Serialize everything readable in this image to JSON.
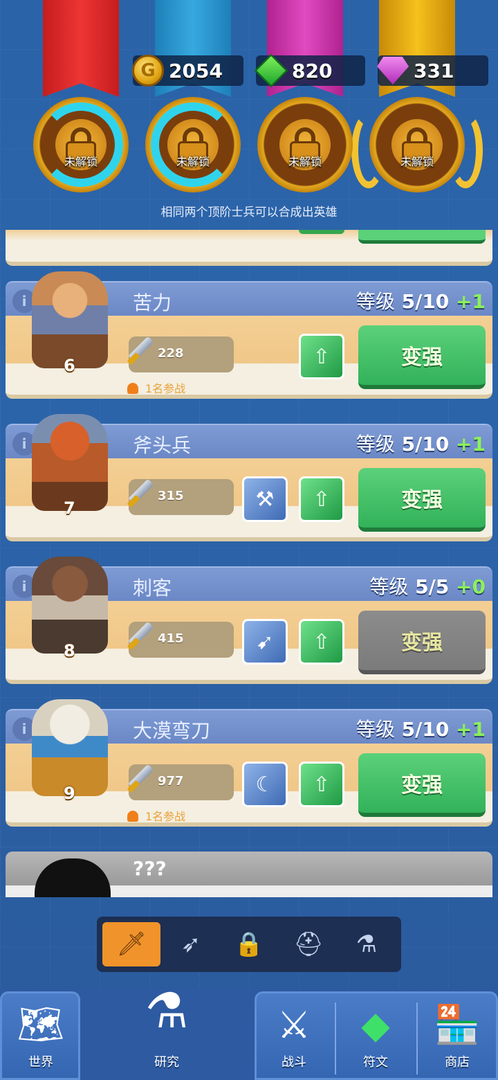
{
  "currencies": {
    "gold": {
      "value": "2054",
      "icon": "gold-coin-icon",
      "glyph": "G"
    },
    "green_gem": {
      "value": "820",
      "icon": "green-gem-icon"
    },
    "purple_gem": {
      "value": "331",
      "icon": "purple-gem-icon"
    }
  },
  "medals": [
    {
      "label": "未解锁",
      "progress": 0.7
    },
    {
      "label": "未解锁",
      "progress": 0.7
    },
    {
      "label": "未解锁",
      "progress": 0
    },
    {
      "label": "未解锁",
      "progress": 0
    }
  ],
  "hint": "相同两个顶阶士兵可以合成出英雄",
  "units": [
    {
      "name": "苦力",
      "level_label": "等级",
      "level": "5/10",
      "plus": "+1",
      "attack": "228",
      "participants": "1名参战",
      "tier": "6",
      "button": "变强",
      "button_state": "active",
      "skill": false
    },
    {
      "name": "斧头兵",
      "level_label": "等级",
      "level": "5/10",
      "plus": "+1",
      "attack": "315",
      "participants": "",
      "tier": "7",
      "button": "变强",
      "button_state": "active",
      "skill": true
    },
    {
      "name": "刺客",
      "level_label": "等级",
      "level": "5/5",
      "plus": "+0",
      "attack": "415",
      "participants": "",
      "tier": "8",
      "button": "变强",
      "button_state": "disabled",
      "skill": true
    },
    {
      "name": "大漠弯刀",
      "level_label": "等级",
      "level": "5/10",
      "plus": "+1",
      "attack": "977",
      "participants": "1名参战",
      "tier": "9",
      "button": "变强",
      "button_state": "active",
      "skill": true
    }
  ],
  "locked_unit": {
    "name": "???"
  },
  "info_glyph": "i",
  "category_tabs": [
    {
      "icon": "sword-icon",
      "glyph": "🗡",
      "active": true
    },
    {
      "icon": "arrow-icon",
      "glyph": "➶",
      "active": false
    },
    {
      "icon": "lock-icon",
      "glyph": "🔒",
      "active": false
    },
    {
      "icon": "helmet-icon",
      "glyph": "⛑",
      "active": false
    },
    {
      "icon": "flask-icon",
      "glyph": "⚗",
      "active": false
    }
  ],
  "nav": {
    "world": {
      "label": "世界",
      "icon": "map-icon",
      "glyph": "🗺"
    },
    "research": {
      "label": "研究",
      "icon": "flask-icon",
      "glyph": "⚗"
    },
    "battle": {
      "label": "战斗",
      "icon": "crossed-swords-icon",
      "glyph": "⚔"
    },
    "runes": {
      "label": "符文",
      "icon": "rune-gem-icon",
      "glyph": "◆"
    },
    "shop": {
      "label": "商店",
      "icon": "shop-icon",
      "glyph": "🏪"
    }
  },
  "colors": {
    "level_plus": "#8cf05a",
    "button_green": "#32b25a",
    "button_gray": "#7b7b7b",
    "tab_active": "#f0932a"
  }
}
